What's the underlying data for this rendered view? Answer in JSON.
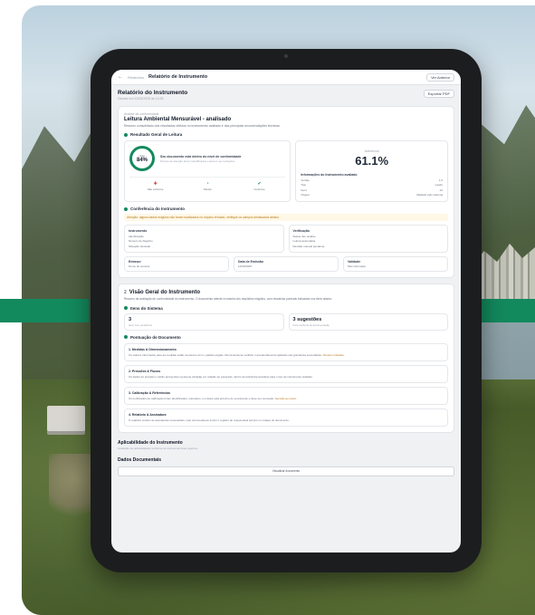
{
  "topbar": {
    "back": "←",
    "crumb": "Relatórios",
    "title": "Relatório de Instrumento",
    "action": "Ver Anterior"
  },
  "header": {
    "title": "Relatório do Instrumento",
    "subtitle": "Gerado em 12/03/2025 às 14:28",
    "action": "Exportar PDF"
  },
  "summary": {
    "label": "Análise de conformidade",
    "title": "Leitura Ambiental Mensurável - analisado",
    "desc": "Resumo consolidado dos resultados obtidos no instrumento avaliado e das principais recomendações técnicas.",
    "section": "Resultado Geral de Leitura"
  },
  "score": {
    "ring_label": "Nota",
    "ring_value": "84%",
    "line1": "Seu documento está dentro do nível de conformidade",
    "line2": "Pontos de atenção foram identificados e devem ser revisados.",
    "kpis": [
      {
        "icon": "✚",
        "label": "Não conforme"
      },
      {
        "icon": "◔",
        "label": "Parcial"
      },
      {
        "icon": "✔",
        "label": "Conforme"
      }
    ],
    "big_label": "Aderência",
    "big_value": "61.1%",
    "meta_title": "Informações do Instrumento avaliado",
    "meta": [
      {
        "k": "Versão",
        "v": "1.0"
      },
      {
        "k": "Tipo",
        "v": "Laudo"
      },
      {
        "k": "Itens",
        "v": "24"
      },
      {
        "k": "Origem",
        "v": "Validado pelo sistema"
      }
    ]
  },
  "checks": {
    "section": "Conferência do Instrumento",
    "warning": "Atenção: alguns dados exigidos não foram localizados no arquivo enviado, verifique os campos destacados abaixo.",
    "box1": {
      "title": "Instrumento",
      "lines": [
        "Identificação",
        "Número do Registro",
        "Situação: Enviado"
      ]
    },
    "box2": {
      "title": "Verificação",
      "lines": [
        "Status: Em análise",
        "Leitura automática",
        "Revisão manual pendente"
      ]
    },
    "row3": [
      {
        "title": "Emissor",
        "line": "Nome do emissor"
      },
      {
        "title": "Data de Emissão",
        "line": "12/03/2025"
      },
      {
        "title": "Validade",
        "line": "Não informada"
      }
    ]
  },
  "analysis": {
    "num": "2",
    "title": "Visão Geral do Instrumento",
    "intro": "Resumo da avaliação de conformidade do instrumento. O documento atende à maioria dos requisitos exigidos, com ressalvas pontuais indicadas nos itens abaixo.",
    "subsection": "Itens do Sistema",
    "stats": [
      {
        "value": "3",
        "label": "Itens com pendência"
      },
      {
        "value": "3 sugestões",
        "label": "Para melhoria da documentação"
      }
    ],
    "subsection2": "Pontuação do Documento",
    "items": [
      {
        "title": "1. Medidas & Dimensionamento",
        "desc": "Os valores informados para as medidas estão coerentes com o padrão exigido. Recomenda-se verificar o arredondamento aplicado nas grandezas secundárias.",
        "hl": "Revisar unidades."
      },
      {
        "title": "2. Pressões & Fluxos",
        "desc": "Os dados de pressão e vazão apresentam pequena variação em relação ao esperado, dentro da tolerância aceitável para o tipo de instrumento avaliado.",
        "hl": ""
      },
      {
        "title": "3. Calibração & Referências",
        "desc": "Os certificados de calibração foram identificados; entretanto, um deles está próximo do vencimento e deve ser renovado.",
        "hl": "Atenção ao prazo."
      },
      {
        "title": "4. Relatório & Assinatura",
        "desc": "O relatório contém as assinaturas necessárias, mas recomenda-se incluir o registro do responsável técnico no rodapé do documento.",
        "hl": ""
      }
    ]
  },
  "sections": [
    {
      "title": "Aplicabilidade do Instrumento",
      "desc": "Avaliação de aplicabilidade conforme as normas técnicas vigentes."
    },
    {
      "title": "Dados Documentais",
      "desc": "",
      "button": "Visualizar documento"
    }
  ]
}
